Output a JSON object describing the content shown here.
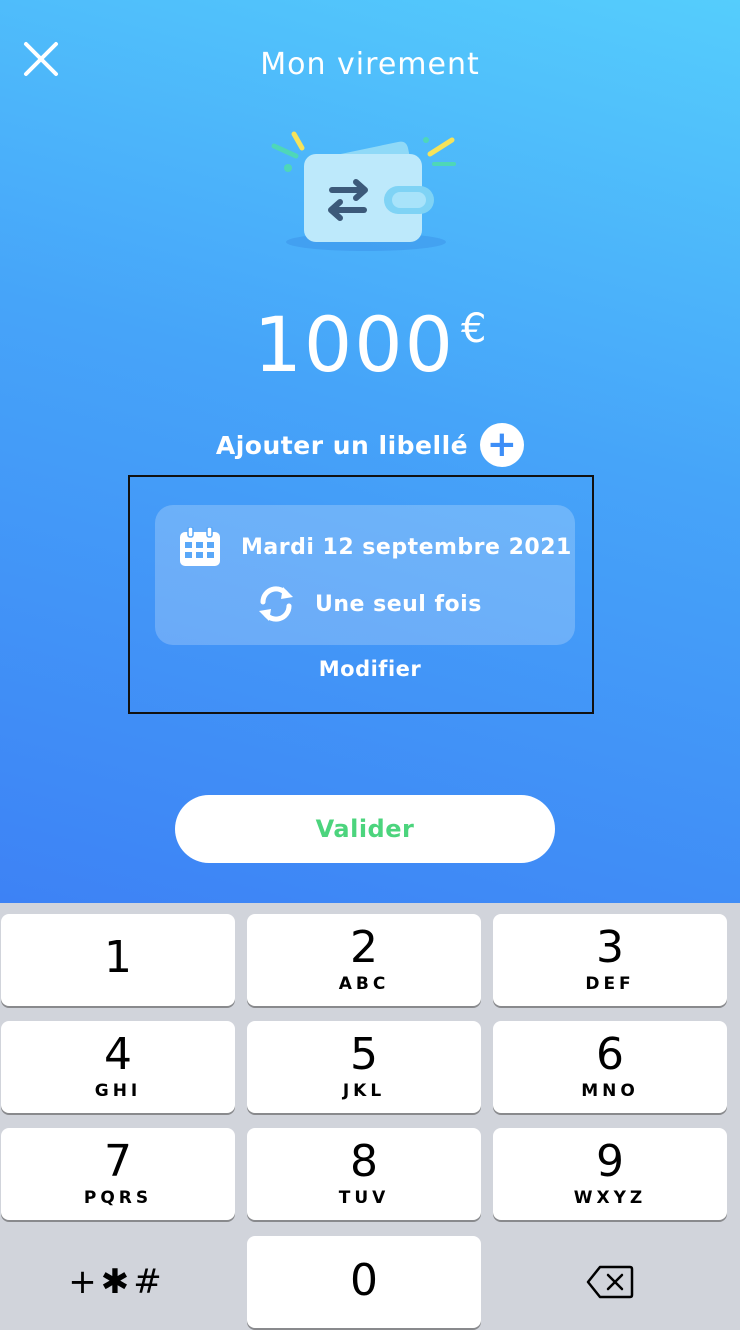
{
  "header": {
    "title": "Mon virement",
    "close_icon": "close-icon"
  },
  "illustration": {
    "icon": "wallet-transfer-icon"
  },
  "amount": {
    "value": "1000",
    "currency": "€"
  },
  "label": {
    "text": "Ajouter un libellé",
    "add_icon_glyph": "+"
  },
  "schedule": {
    "date": "Mardi 12 septembre 2021",
    "date_icon": "calendar-icon",
    "frequency": "Une seul fois",
    "frequency_icon": "repeat-icon",
    "edit_label": "Modifier"
  },
  "actions": {
    "validate_label": "Valider"
  },
  "keypad": {
    "keys": [
      {
        "digit": "1",
        "letters": ""
      },
      {
        "digit": "2",
        "letters": "ABC"
      },
      {
        "digit": "3",
        "letters": "DEF"
      },
      {
        "digit": "4",
        "letters": "GHI"
      },
      {
        "digit": "5",
        "letters": "JKL"
      },
      {
        "digit": "6",
        "letters": "MNO"
      },
      {
        "digit": "7",
        "letters": "PQRS"
      },
      {
        "digit": "8",
        "letters": "TUV"
      },
      {
        "digit": "9",
        "letters": "WXYZ"
      },
      {
        "digit": "0",
        "letters": ""
      }
    ],
    "symbols_label": "+✱#",
    "delete_icon": "backspace-icon"
  },
  "colors": {
    "gradient_top": "#55cdfc",
    "gradient_bottom": "#3d82f5",
    "accent_green": "#4cd47d",
    "keypad_bg": "#d1d4db"
  }
}
